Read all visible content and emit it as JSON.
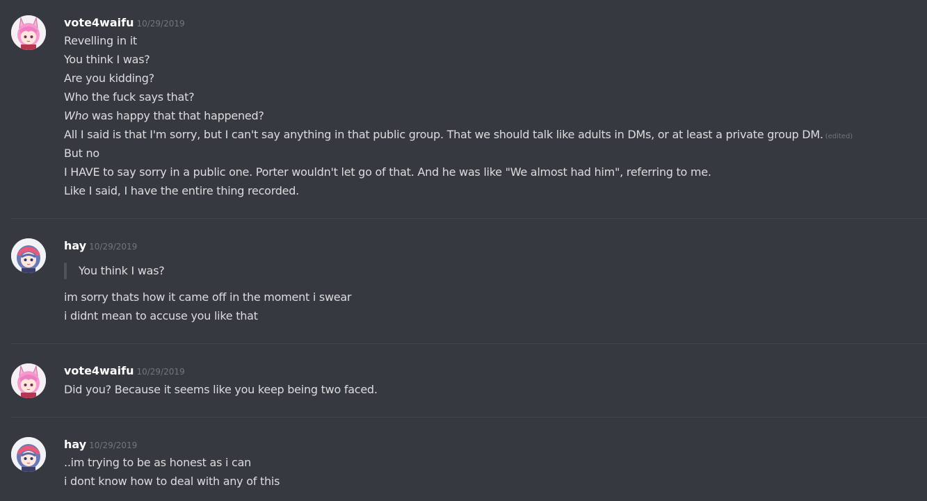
{
  "messages": [
    {
      "username": "vote4waifu",
      "timestamp": "10/29/2019",
      "avatar": "pink-haired-anime-girl",
      "lines": [
        "Revelling in it",
        "You think I was?",
        "Are you kidding?",
        "Who the fuck says that?",
        "was happy that that happened?",
        "All I said is that I'm sorry, but I can't say anything in that public group. That we should talk like adults in DMs, or at least a private group DM.",
        "But no",
        "I HAVE to say sorry in a public one. Porter wouldn't let go of that. And he was like \"We almost had him\", referring to me.",
        "Like I said, I have the entire thing recorded."
      ],
      "italic_word": "Who",
      "edited_label": "(edited)"
    },
    {
      "username": "hay",
      "timestamp": "10/29/2019",
      "avatar": "blue-haired-anime-girl",
      "quote": "You think I was?",
      "lines": [
        "im sorry thats how it came off in the moment i swear",
        "i didnt mean to accuse you like that"
      ]
    },
    {
      "username": "vote4waifu",
      "timestamp": "10/29/2019",
      "avatar": "pink-haired-anime-girl",
      "lines": [
        "Did you? Because it seems like you keep being two faced."
      ]
    },
    {
      "username": "hay",
      "timestamp": "10/29/2019",
      "avatar": "blue-haired-anime-girl",
      "lines": [
        "..im trying to be as honest as i can",
        "i dont know how to deal with any of this"
      ]
    }
  ],
  "colors": {
    "background": "#36393f",
    "username": "#ffffff",
    "text": "#dcddde",
    "timestamp": "#72767d",
    "quote_bar": "#4f545c",
    "divider": "#42454a"
  }
}
